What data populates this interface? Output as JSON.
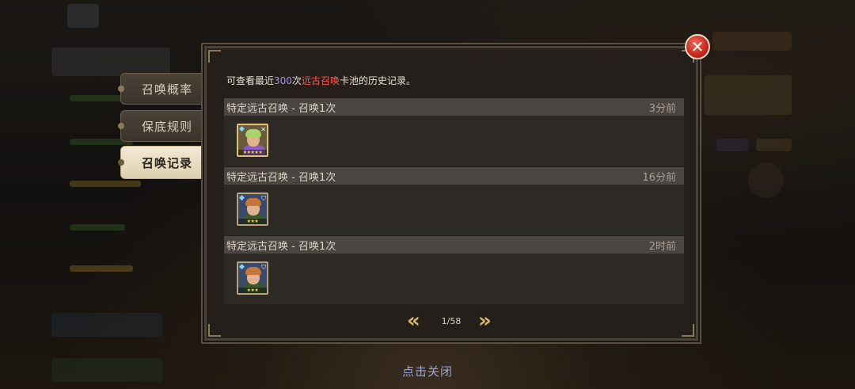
{
  "tabs": [
    {
      "label": "召唤概率",
      "active": false
    },
    {
      "label": "保底规则",
      "active": false
    },
    {
      "label": "召唤记录",
      "active": true
    }
  ],
  "info": {
    "prefix": "可查看最近",
    "count": "300",
    "mid": "次",
    "pool": "远古召唤",
    "suffix": "卡池的历史记录。"
  },
  "records": [
    {
      "title": "特定远古召唤 - 召唤1次",
      "time": "3分前",
      "hero": {
        "stars": "★★★★★",
        "rarity": "gold",
        "hair": "#a9d46a",
        "body": "#8b5fbf",
        "bg": "#6a5a3c"
      }
    },
    {
      "title": "特定远古召唤 - 召唤1次",
      "time": "16分前",
      "hero": {
        "stars": "★★★",
        "rarity": "silver",
        "hair": "#c4763a",
        "body": "#3a5a2e",
        "bg": "#3a4a6a"
      }
    },
    {
      "title": "特定远古召唤 - 召唤1次",
      "time": "2时前",
      "hero": {
        "stars": "★★★",
        "rarity": "silver",
        "hair": "#c4763a",
        "body": "#3a5a2e",
        "bg": "#3a4a6a"
      }
    }
  ],
  "pager": {
    "page": "1/58",
    "prev_icon": "double-chevron-left",
    "next_icon": "double-chevron-right"
  },
  "close_hint": "点击关闭",
  "colors": {
    "accent_purple": "#a58cff",
    "accent_red": "#ff5a4a",
    "close_red": "#c6281c",
    "gold": "#d9b86a"
  }
}
